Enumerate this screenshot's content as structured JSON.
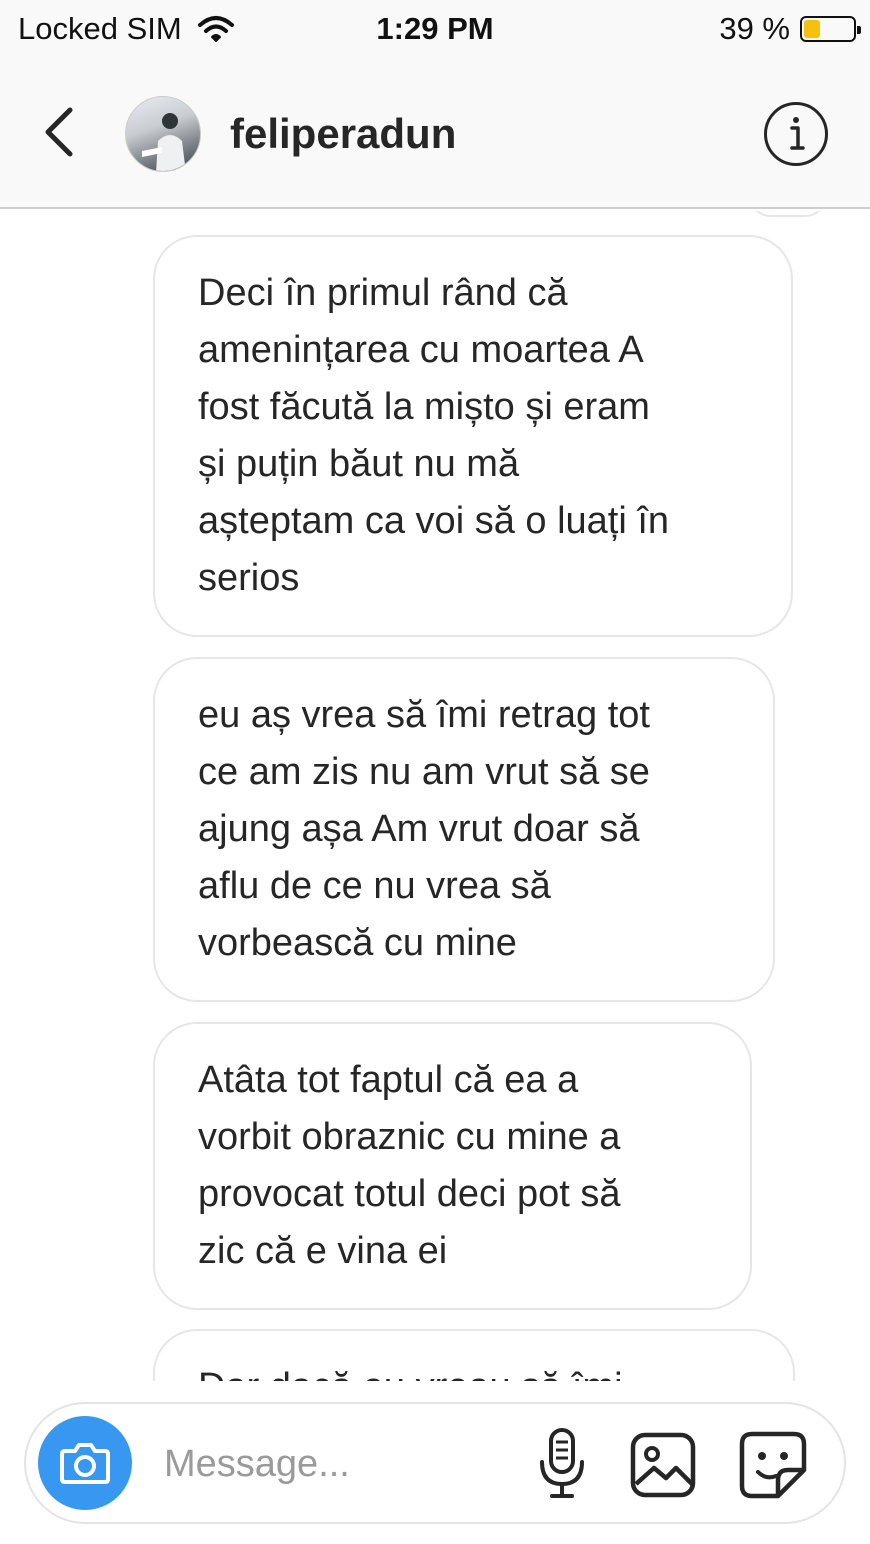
{
  "status_bar": {
    "carrier": "Locked SIM",
    "time": "1:29 PM",
    "battery_percent": "39 %",
    "battery_level": 0.39,
    "battery_color": "#f4c20d"
  },
  "header": {
    "username": "feliperadun",
    "back_icon": "chevron-left-icon",
    "info_icon": "info-circle-icon"
  },
  "messages": [
    {
      "text": "Deci în primul rând că\namenințarea cu moartea A\nfost făcută la mișto și eram\nși puțin băut nu mă\nașteptam ca voi să o luați în\nserios"
    },
    {
      "text": "eu aș vrea să îmi retrag tot\nce am zis nu am vrut să se\najung așa Am vrut doar să\naflu de ce nu vrea să\nvorbească cu mine"
    },
    {
      "text": "Atâta tot faptul că ea a\nvorbit obraznic cu mine a\nprovocat totul deci pot să\nzic că e vina ei"
    },
    {
      "text": "Dar dacă eu vreau să îmi"
    }
  ],
  "composer": {
    "placeholder": "Message...",
    "camera_icon": "camera-icon",
    "mic_icon": "microphone-icon",
    "gallery_icon": "gallery-icon",
    "sticker_icon": "sticker-icon",
    "accent_color": "#3897f0"
  }
}
